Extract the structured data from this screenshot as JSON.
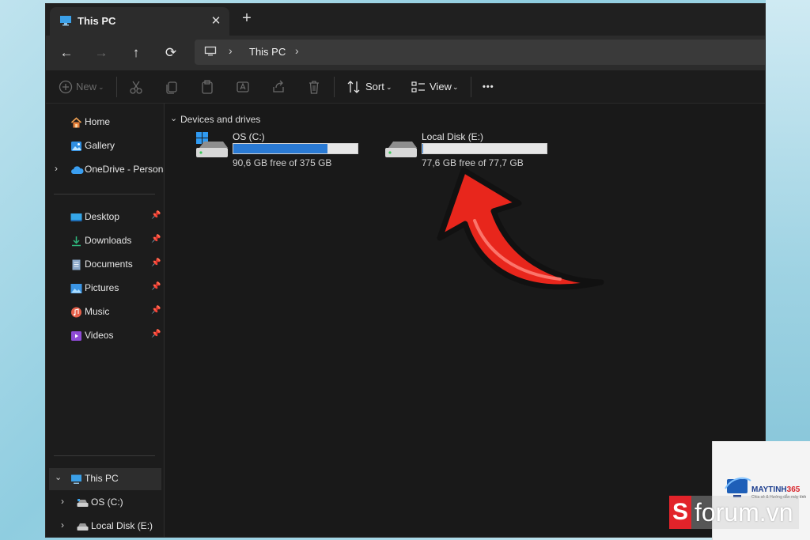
{
  "window": {
    "tab_title": "This PC",
    "tab_close": "✕",
    "tab_new": "+"
  },
  "nav": {
    "back": "←",
    "forward": "→",
    "up": "↑",
    "refresh": "⟳",
    "breadcrumb": "This PC"
  },
  "toolbar": {
    "new_label": "New",
    "sort_label": "Sort",
    "view_label": "View",
    "more_label": "•••"
  },
  "sidebar": {
    "top_items": [
      {
        "label": "Home",
        "icon": "home-icon"
      },
      {
        "label": "Gallery",
        "icon": "gallery-icon"
      },
      {
        "label": "OneDrive - Persona",
        "icon": "onedrive-icon"
      }
    ],
    "pinned_items": [
      {
        "label": "Desktop",
        "icon": "desktop-icon"
      },
      {
        "label": "Downloads",
        "icon": "downloads-icon"
      },
      {
        "label": "Documents",
        "icon": "documents-icon"
      },
      {
        "label": "Pictures",
        "icon": "pictures-icon"
      },
      {
        "label": "Music",
        "icon": "music-icon"
      },
      {
        "label": "Videos",
        "icon": "videos-icon"
      }
    ],
    "tree_items": [
      {
        "label": "This PC",
        "icon": "this-pc-icon",
        "selected": true
      },
      {
        "label": "OS (C:)",
        "icon": "drive-icon"
      },
      {
        "label": "Local Disk (E:)",
        "icon": "drive-icon"
      }
    ]
  },
  "content": {
    "group_header": "Devices and drives",
    "drives": [
      {
        "name": "OS (C:)",
        "free_text": "90,6 GB free of 375 GB",
        "used_fraction": 0.758
      },
      {
        "name": "Local Disk (E:)",
        "free_text": "77,6 GB free of 77,7 GB",
        "used_fraction": 0.001
      }
    ]
  },
  "watermarks": {
    "maytinh_name": "MAYTINH",
    "maytinh_num": "365",
    "maytinh_sub": "Chia sẻ & Hướng dẫn máy tính",
    "forum_s": "S",
    "forum_text": "forum.vn"
  },
  "colors": {
    "accent": "#2a7ad4",
    "arrow": "#e8261c",
    "window_bg": "#1c1c1c"
  }
}
